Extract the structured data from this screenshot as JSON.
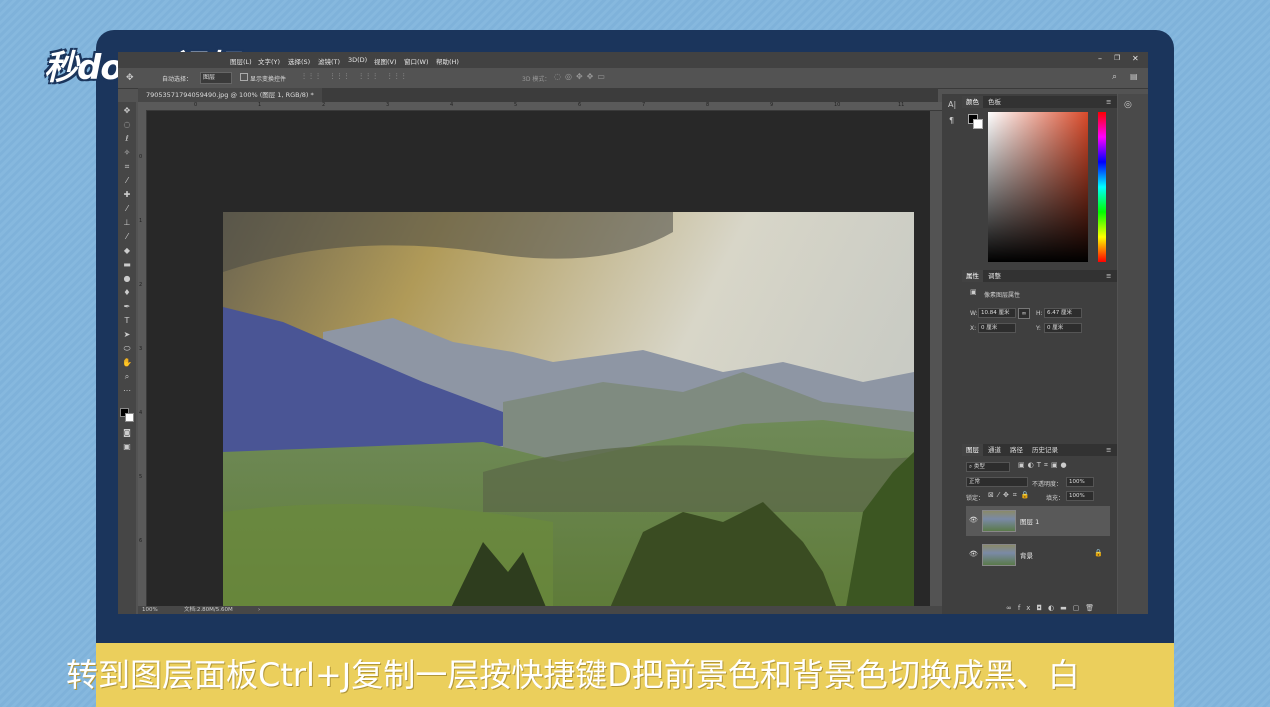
{
  "logo": {
    "text": "秒dong视频"
  },
  "menubar": {
    "items": [
      "图层(L)",
      "文字(Y)",
      "选择(S)",
      "滤镜(T)",
      "3D(D)",
      "视图(V)",
      "窗口(W)",
      "帮助(H)"
    ]
  },
  "options_bar": {
    "auto_select_label": "自动选择：",
    "auto_select_value": "图层",
    "transform_controls_label": "显示变换控件",
    "mode_3d_label": "3D 模式："
  },
  "document": {
    "tab_title": "79053571794059490.jpg @ 100% (图层 1, RGB/8) *",
    "zoom": "100%",
    "doc_info": "文档:2.80M/5.60M",
    "ruler_top_ticks": [
      "0",
      "1",
      "2",
      "3",
      "4",
      "5",
      "6",
      "7",
      "8",
      "9",
      "10",
      "11"
    ],
    "ruler_left_ticks": [
      "0",
      "1",
      "2",
      "3",
      "4",
      "5",
      "6"
    ]
  },
  "color_panel": {
    "tabs": [
      "颜色",
      "色板"
    ],
    "accent_color": "#d94a2a"
  },
  "properties_panel": {
    "tabs": [
      "属性",
      "调整"
    ],
    "title": "像素图层属性",
    "w_label": "W:",
    "w_value": "10.84 厘米",
    "h_label": "H:",
    "h_value": "6.47 厘米",
    "x_label": "X:",
    "x_value": "0 厘米",
    "y_label": "Y:",
    "y_value": "0 厘米"
  },
  "layers_panel": {
    "tabs": [
      "图层",
      "通道",
      "路径",
      "历史记录"
    ],
    "filter_kind": "类型",
    "blend_mode": "正常",
    "opacity_label": "不透明度：",
    "opacity_value": "100%",
    "lock_label": "锁定：",
    "fill_label": "填充：",
    "fill_value": "100%",
    "layers": [
      {
        "name": "图层 1",
        "selected": true
      },
      {
        "name": "背景",
        "selected": false,
        "locked": true
      }
    ]
  },
  "caption": {
    "text": "转到图层面板Ctrl+J复制一层按快捷键D把前景色和背景色切换成黑、白"
  }
}
